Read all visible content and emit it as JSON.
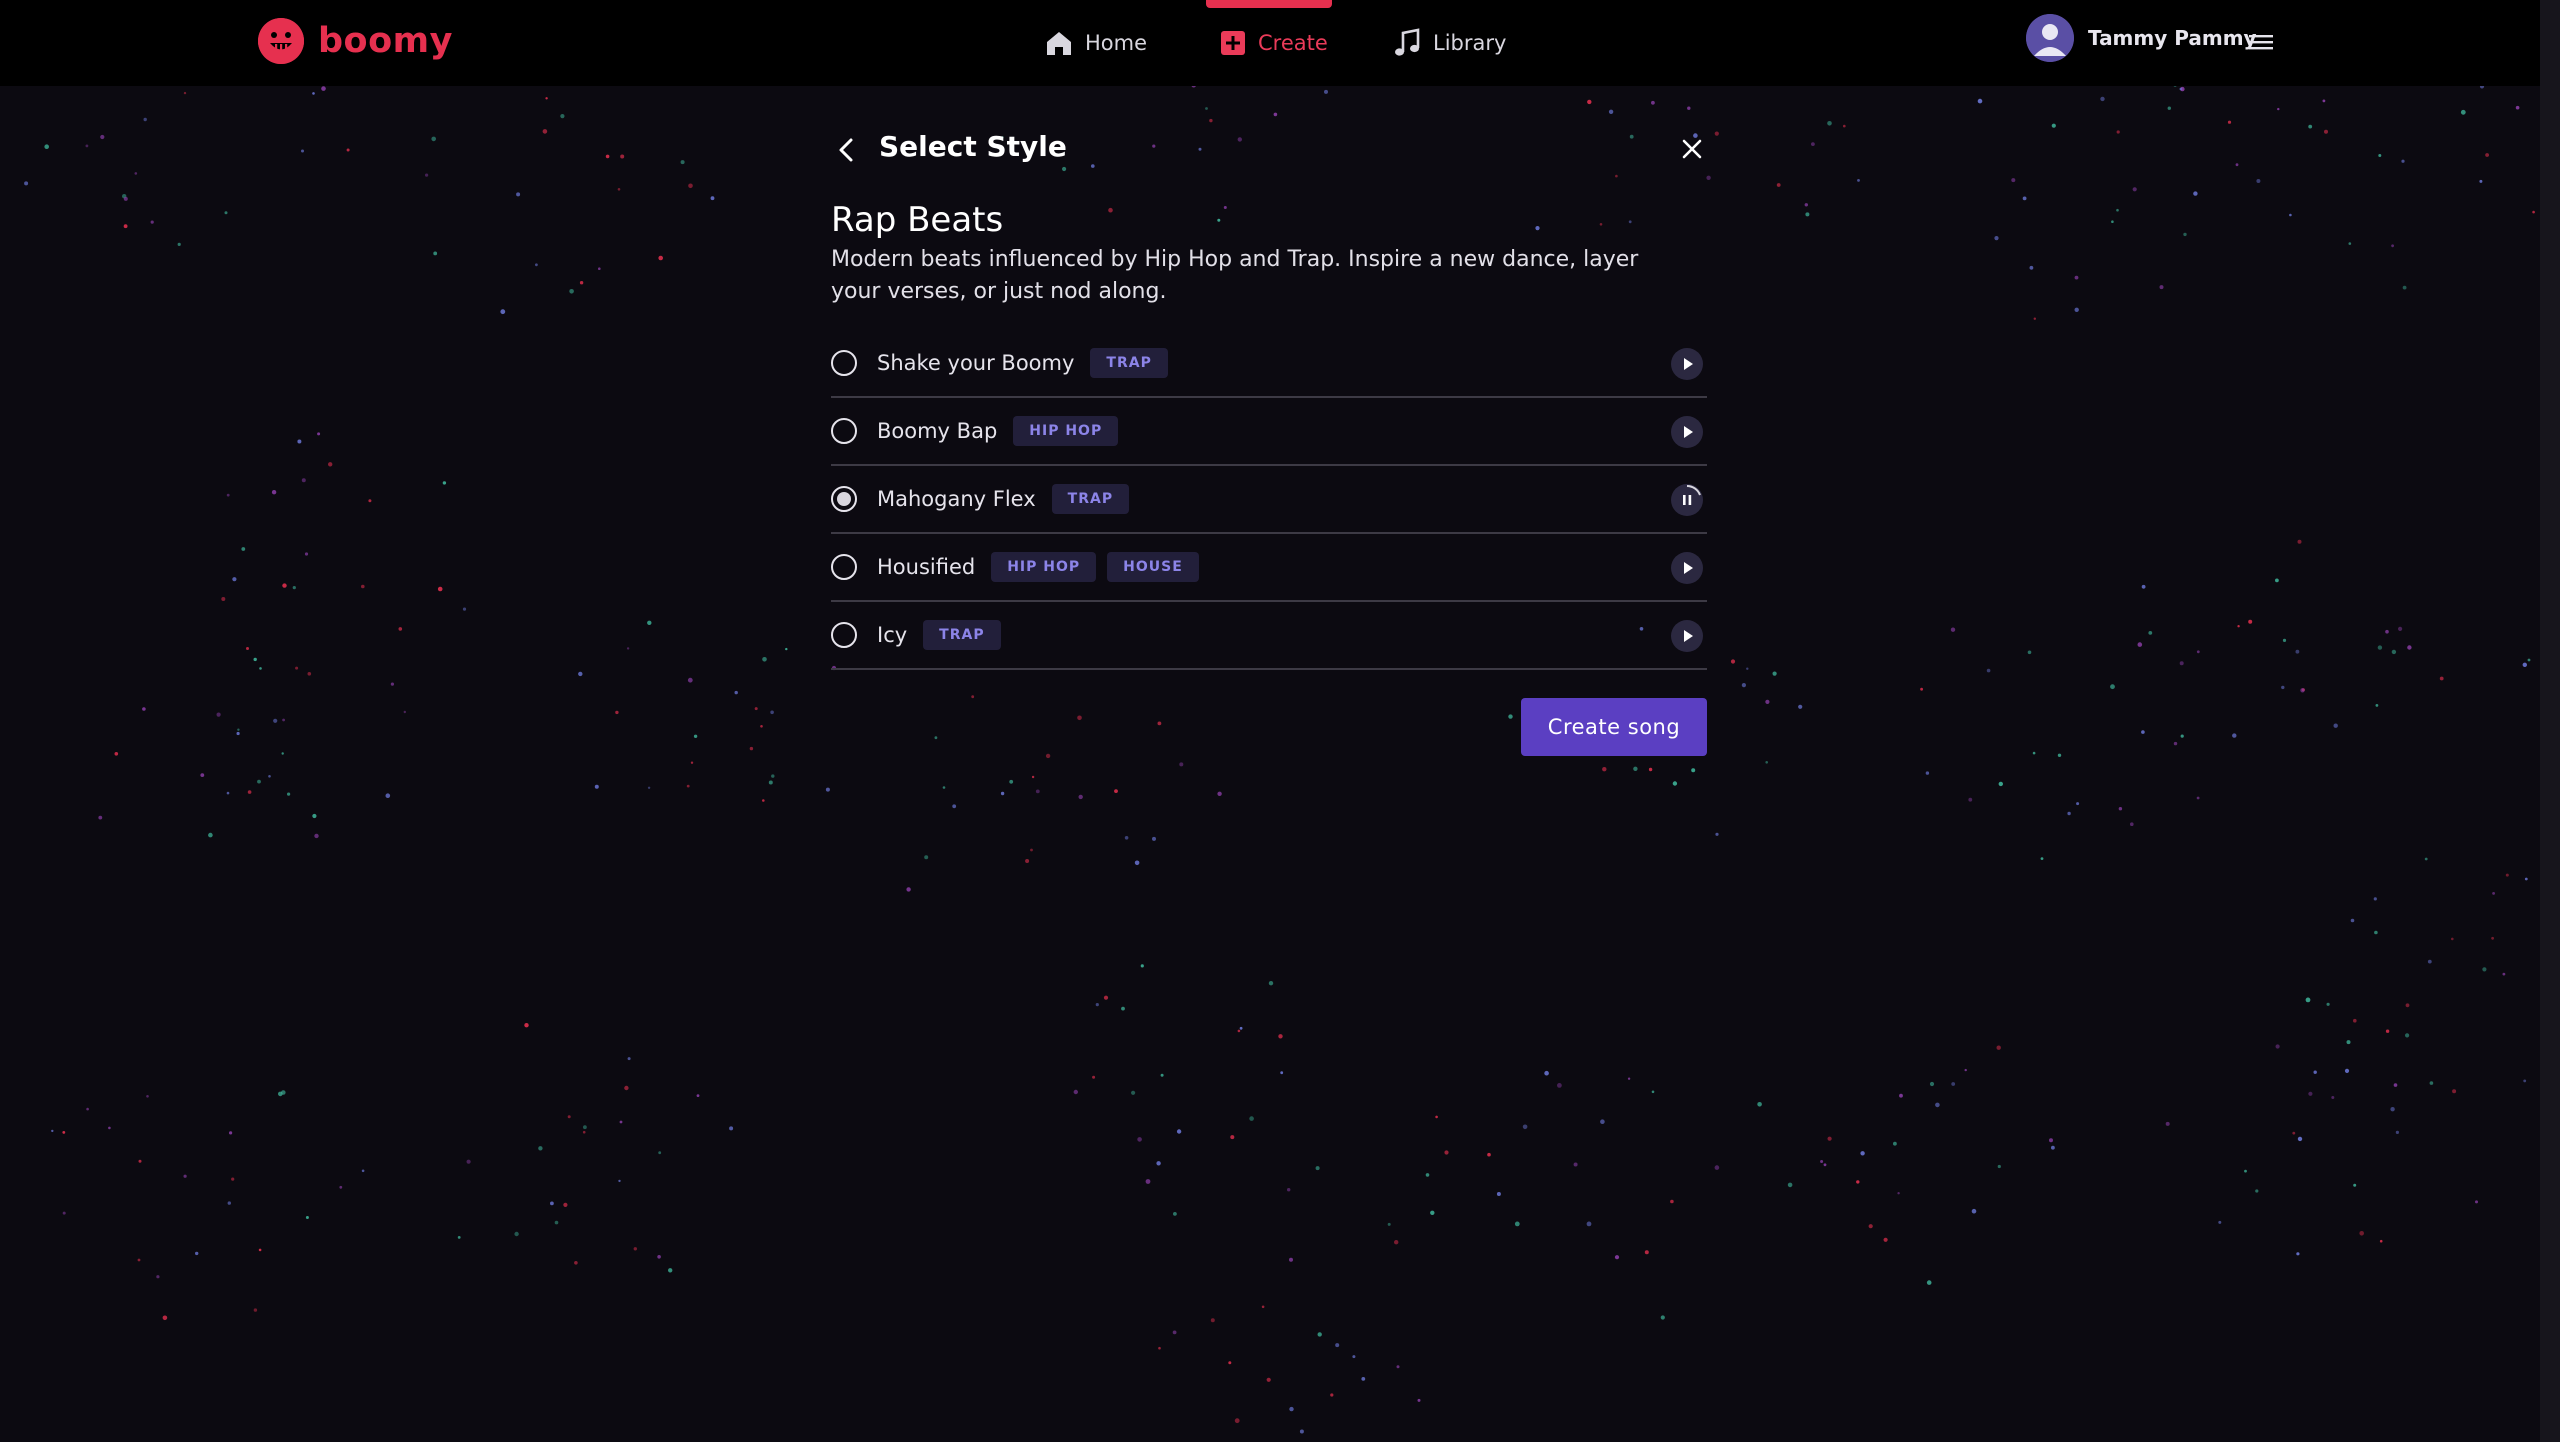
{
  "header": {
    "logo_text": "boomy",
    "nav": {
      "home": "Home",
      "create": "Create",
      "library": "Library"
    },
    "user_name": "Tammy Pammy"
  },
  "panel": {
    "title": "Select Style",
    "style_name": "Rap Beats",
    "style_description": "Modern beats influenced by Hip Hop and Trap. Inspire a new dance, layer your verses, or just nod along.",
    "tracks": [
      {
        "name": "Shake your Boomy",
        "tags": [
          "TRAP"
        ],
        "selected": false,
        "state": "play"
      },
      {
        "name": "Boomy Bap",
        "tags": [
          "HIP HOP"
        ],
        "selected": false,
        "state": "play"
      },
      {
        "name": "Mahogany Flex",
        "tags": [
          "TRAP"
        ],
        "selected": true,
        "state": "pause"
      },
      {
        "name": "Housified",
        "tags": [
          "HIP HOP",
          "HOUSE"
        ],
        "selected": false,
        "state": "play"
      },
      {
        "name": "Icy",
        "tags": [
          "TRAP"
        ],
        "selected": false,
        "state": "play"
      }
    ],
    "create_button": "Create song"
  },
  "colors": {
    "brand": "#e6304f",
    "accent": "#5b3fc2",
    "tag_text": "#8c84e8",
    "background": "#0c0a11"
  },
  "icons": {
    "home": "home-icon",
    "create": "plus-square-icon",
    "library": "music-note-icon",
    "back": "chevron-left-icon",
    "close": "close-icon",
    "menu": "hamburger-menu-icon"
  }
}
